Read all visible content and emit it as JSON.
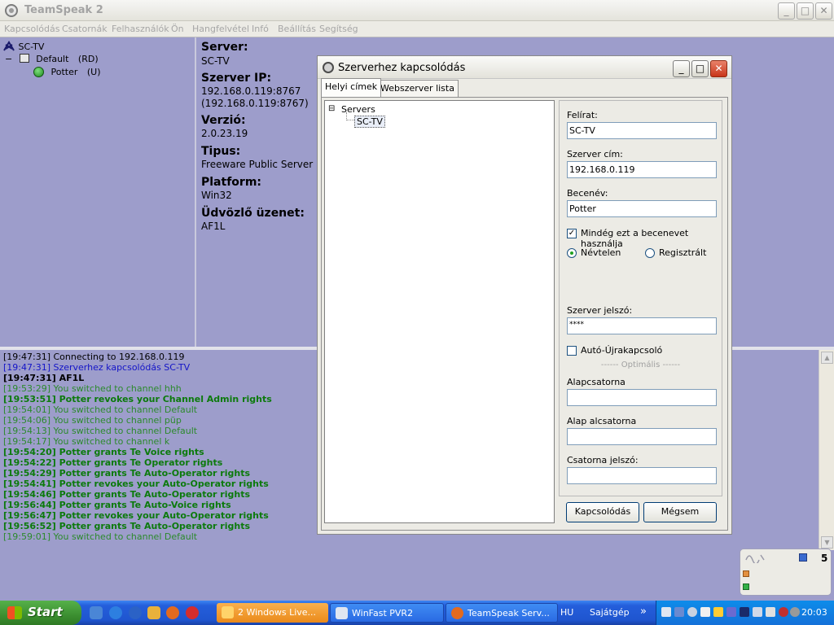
{
  "app": {
    "title": "TeamSpeak 2"
  },
  "menu": [
    "Kapcsolódás",
    "Csatornák",
    "Felhasználók",
    "Ön",
    "Hangfelvétel",
    "Infó",
    "Beállítás",
    "Segítség"
  ],
  "tree": {
    "server": "SC-TV",
    "channel": "Default",
    "channel_flag": "(RD)",
    "user": "Potter",
    "user_flag": "(U)",
    "collapse": "−"
  },
  "info": {
    "server_label": "Server:",
    "server_value": "SC-TV",
    "ip_label": "Szerver IP:",
    "ip_value": "192.168.0.119:8767",
    "ip_value2": "(192.168.0.119:8767)",
    "version_label": "Verzió:",
    "version_value": "2.0.23.19",
    "type_label": "Tipus:",
    "type_value": "Freeware Public Server",
    "platform_label": "Platform:",
    "platform_value": "Win32",
    "welcome_label": "Üdvözlő üzenet:",
    "welcome_value": "AF1L"
  },
  "log": [
    {
      "text": "[19:47:31] Connecting to 192.168.0.119",
      "color": "#000000",
      "bold": false
    },
    {
      "text": "[19:47:31] Szerverhez kapcsolódás SC-TV",
      "color": "#1414c8",
      "bold": false
    },
    {
      "text": "[19:47:31] AF1L",
      "color": "#000000",
      "bold": true
    },
    {
      "text": "[19:53:29] You switched to channel hhh",
      "color": "#2c8a2c",
      "bold": false
    },
    {
      "text": "[19:53:51] Potter revokes your Channel Admin rights",
      "color": "#0c7a0c",
      "bold": true
    },
    {
      "text": "[19:54:01] You switched to channel Default",
      "color": "#2c8a2c",
      "bold": false
    },
    {
      "text": "[19:54:06] You switched to channel püp",
      "color": "#2c8a2c",
      "bold": false
    },
    {
      "text": "[19:54:13] You switched to channel Default",
      "color": "#2c8a2c",
      "bold": false
    },
    {
      "text": "[19:54:17] You switched to channel k",
      "color": "#2c8a2c",
      "bold": false
    },
    {
      "text": "[19:54:20] Potter grants Te Voice rights",
      "color": "#0c7a0c",
      "bold": true
    },
    {
      "text": "[19:54:22] Potter grants Te Operator rights",
      "color": "#0c7a0c",
      "bold": true
    },
    {
      "text": "[19:54:29] Potter grants Te Auto-Operator rights",
      "color": "#0c7a0c",
      "bold": true
    },
    {
      "text": "[19:54:41] Potter revokes your Auto-Operator rights",
      "color": "#0c7a0c",
      "bold": true
    },
    {
      "text": "[19:54:46] Potter grants Te Auto-Operator rights",
      "color": "#0c7a0c",
      "bold": true
    },
    {
      "text": "[19:56:44] Potter grants Te Auto-Voice rights",
      "color": "#0c7a0c",
      "bold": true
    },
    {
      "text": "[19:56:47] Potter revokes your Auto-Operator rights",
      "color": "#0c7a0c",
      "bold": true
    },
    {
      "text": "[19:56:52] Potter grants Te Auto-Operator rights",
      "color": "#0c7a0c",
      "bold": true
    },
    {
      "text": "[19:59:01] You switched to channel Default",
      "color": "#2c8a2c",
      "bold": false
    }
  ],
  "dialog": {
    "title": "Szerverhez kapcsolódás",
    "tabs": [
      "Helyi címek",
      "Webszerver lista"
    ],
    "tree_root": "Servers",
    "tree_item": "SC-TV",
    "expander": "⊟",
    "label_label": "Felírat:",
    "label_value": "SC-TV",
    "address_label": "Szerver cím:",
    "address_value": "192.168.0.119",
    "nick_label": "Becenév:",
    "nick_value": "Potter",
    "always_nick_label": "Mindég ezt a becenevet használja",
    "always_nick_checked": true,
    "anon_label": "Névtelen",
    "registered_label": "Regisztrált",
    "anonymous_selected": true,
    "password_label": "Szerver jelszó:",
    "password_value": "****",
    "auto_reconnect_label": "Autó-Újrakapcsoló",
    "auto_reconnect_checked": false,
    "optional_label": "------ Optimális ------",
    "default_channel_label": "Alapcsatorna",
    "default_channel_value": "",
    "default_subchannel_label": "Alap alcsatorna",
    "default_subchannel_value": "",
    "channel_password_label": "Csatorna jelszó:",
    "channel_password_value": "",
    "connect_button": "Kapcsolódás",
    "cancel_button": "Mégsem",
    "check_mark": "✓"
  },
  "tray_widget": {
    "count": "5"
  },
  "taskbar": {
    "start": "Start",
    "tasks": [
      "2 Windows Live...",
      "WinFast PVR2",
      "TeamSpeak Serv..."
    ],
    "language": "HU",
    "my_computer": "Sajátgép",
    "chevron": "»",
    "clock": "20:03"
  },
  "window_buttons": {
    "minimize": "_",
    "maximize": "□",
    "close": "✕"
  },
  "colors": {
    "background": "#9d9dcb",
    "channel_text": "#0c7a0c",
    "accent": "#245edb"
  }
}
